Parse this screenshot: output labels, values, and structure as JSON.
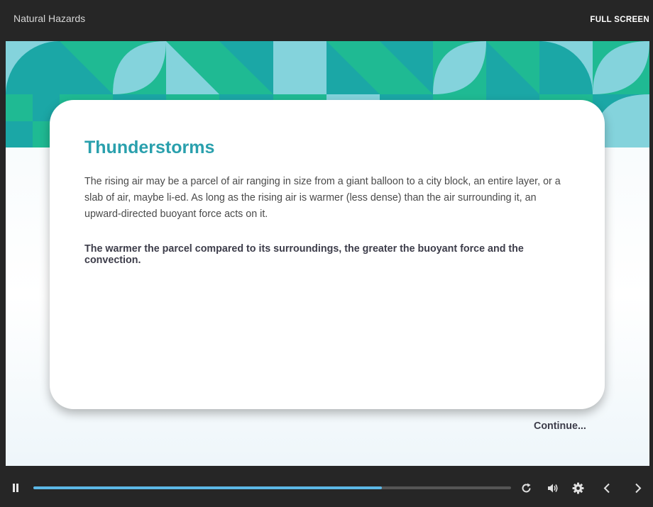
{
  "header": {
    "course_title": "Natural Hazards",
    "fullscreen_label": "FULL SCREEN"
  },
  "slide": {
    "title": "Thunderstorms",
    "body": "The rising air may be a parcel of air ranging in size from a giant balloon to a city block, an entire layer, or a slab of air, maybe li-ed. As long as the rising air is warmer (less dense) than the air surrounding it, an upward-directed buoyant force acts on it.",
    "emphasis": "The warmer the parcel compared to its surroundings, the greater the buoyant force and the convection.",
    "continue_label": "Continue..."
  },
  "player": {
    "progress_fraction": 0.73,
    "icons": [
      "pause-icon",
      "replay-icon",
      "volume-icon",
      "settings-icon",
      "previous-icon",
      "next-icon"
    ]
  },
  "colors": {
    "accent_title": "#2aa0ad",
    "progress": "#5cb8e6",
    "banner_teal": "#1ba7a6",
    "banner_green": "#1fba93",
    "banner_light": "#84d3dc"
  }
}
